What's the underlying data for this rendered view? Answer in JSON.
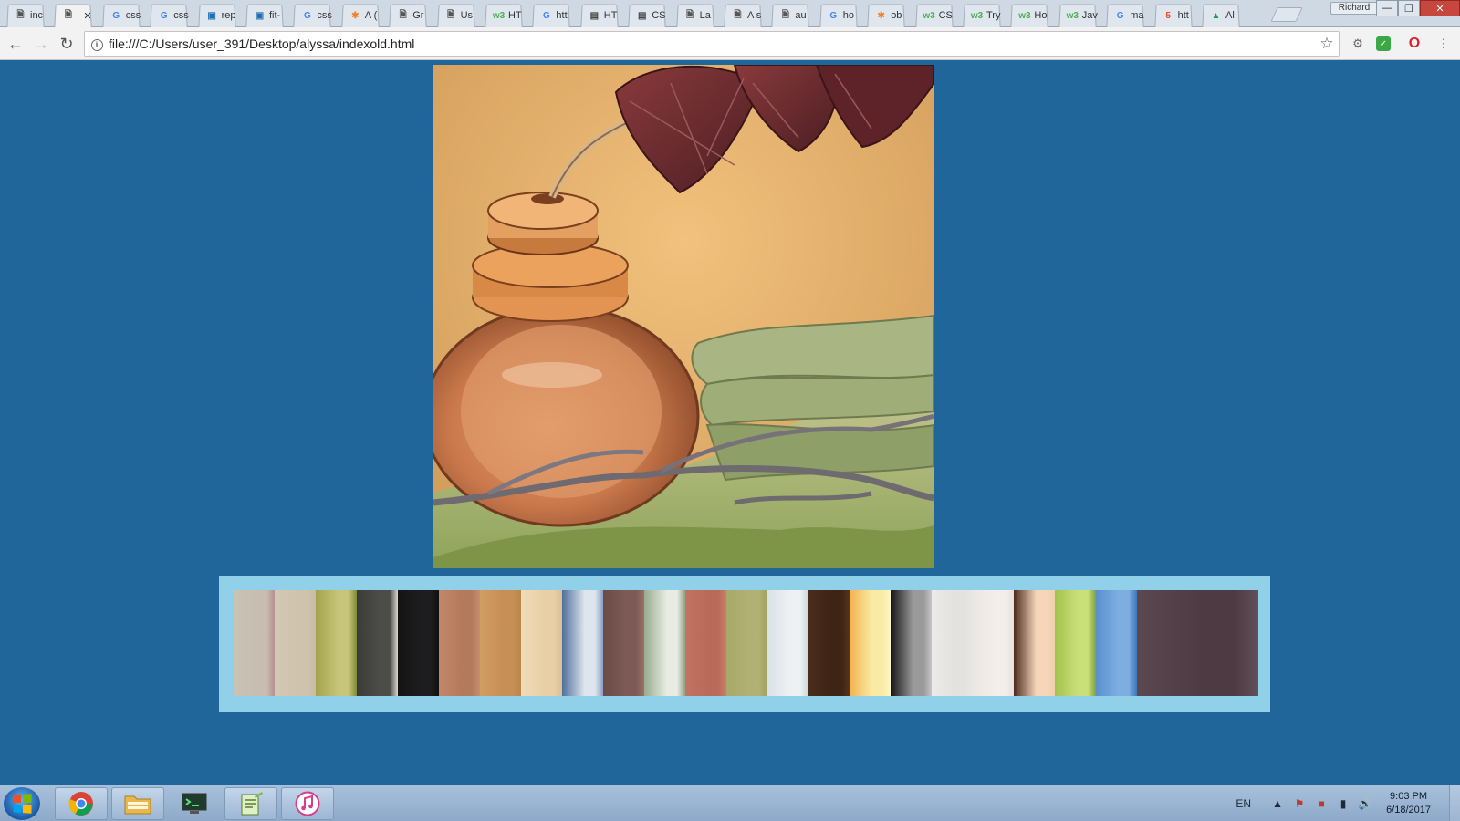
{
  "browser": {
    "tabs": [
      {
        "label": "inc",
        "icon": "page-icon",
        "active": false
      },
      {
        "label": "",
        "icon": "page-icon",
        "active": true
      },
      {
        "label": "css",
        "icon": "google-icon"
      },
      {
        "label": "css",
        "icon": "google-icon"
      },
      {
        "label": "rep",
        "icon": "stackoverflow-icon"
      },
      {
        "label": "fit-",
        "icon": "stackoverflow-icon"
      },
      {
        "label": "css",
        "icon": "google-icon"
      },
      {
        "label": "A (",
        "icon": "asterisk-icon"
      },
      {
        "label": "Gr",
        "icon": "page-icon"
      },
      {
        "label": "Us",
        "icon": "page-icon"
      },
      {
        "label": "HT",
        "icon": "w3schools-icon"
      },
      {
        "label": "htt",
        "icon": "google-icon"
      },
      {
        "label": "HT",
        "icon": "doc-icon"
      },
      {
        "label": "CS",
        "icon": "doc-icon"
      },
      {
        "label": "La",
        "icon": "page-icon"
      },
      {
        "label": "A s",
        "icon": "page-icon"
      },
      {
        "label": "au",
        "icon": "page-icon"
      },
      {
        "label": "ho",
        "icon": "google-icon"
      },
      {
        "label": "ob",
        "icon": "asterisk-icon"
      },
      {
        "label": "CS",
        "icon": "w3schools-icon"
      },
      {
        "label": "Try",
        "icon": "w3schools-icon"
      },
      {
        "label": "Ho",
        "icon": "w3schools-icon"
      },
      {
        "label": "Jav",
        "icon": "w3schools-icon"
      },
      {
        "label": "ma",
        "icon": "google-icon"
      },
      {
        "label": "htt",
        "icon": "html5-icon"
      },
      {
        "label": "Al",
        "icon": "drive-icon"
      }
    ],
    "profile_name": "Richard",
    "url": "file:///C:/Users/user_391/Desktop/alyssa/indexold.html"
  },
  "page": {
    "swatch_colors": [
      [
        "#c9c2b6",
        "#c8bdb0",
        "#b68e92"
      ],
      [
        "#d3c8b5",
        "#cfc3ad",
        "#c9bba6"
      ],
      [
        "#a3a44e",
        "#c6c578",
        "#7e8a38"
      ],
      [
        "#3b3b39",
        "#4c4c48",
        "#ddd6cd"
      ],
      [
        "#141415",
        "#1d1d1f",
        "#101010"
      ],
      [
        "#c18768",
        "#b47a5c",
        "#c69070"
      ],
      [
        "#d19e62",
        "#c78f55",
        "#b88648"
      ],
      [
        "#f1dcb8",
        "#e8cfa6",
        "#d9bf95"
      ],
      [
        "#4e6f9c",
        "#dfe5ee",
        "#8aa0c2"
      ],
      [
        "#6a4b47",
        "#7c5a55",
        "#9a6f6a"
      ],
      [
        "#98ac8f",
        "#e8ece2",
        "#8da183"
      ],
      [
        "#c37362",
        "#b96a58",
        "#cc7d6c"
      ],
      [
        "#a8a868",
        "#b0b172",
        "#9fa15c"
      ],
      [
        "#d9e2e5",
        "#edf1f3",
        "#c9d6da"
      ],
      [
        "#4b2d1c",
        "#3d2414",
        "#56341f"
      ],
      [
        "#f3b04e",
        "#f9eba4",
        "#fdf6c8"
      ],
      [
        "#141414",
        "#9a9a9a",
        "#c6c6c6"
      ],
      [
        "#ecebe9",
        "#e4e2df",
        "#e9e7e4"
      ],
      [
        "#ede7e4",
        "#f4eeeb",
        "#e8e1dd"
      ],
      [
        "#4b2c1f",
        "#f6d5b9",
        "#f1cfb0"
      ],
      [
        "#a3c24c",
        "#c9df77",
        "#7ea33b"
      ],
      [
        "#5a8fcf",
        "#7eaee0",
        "#3f76b9"
      ],
      [
        "#5b4850",
        "#4d3a42",
        "#62505a"
      ]
    ]
  },
  "taskbar": {
    "apps": [
      "start-button",
      "chrome",
      "file-explorer",
      "terminal",
      "notepad-plus",
      "itunes"
    ],
    "lang": "EN",
    "time": "9:03 PM",
    "date": "6/18/2017"
  }
}
